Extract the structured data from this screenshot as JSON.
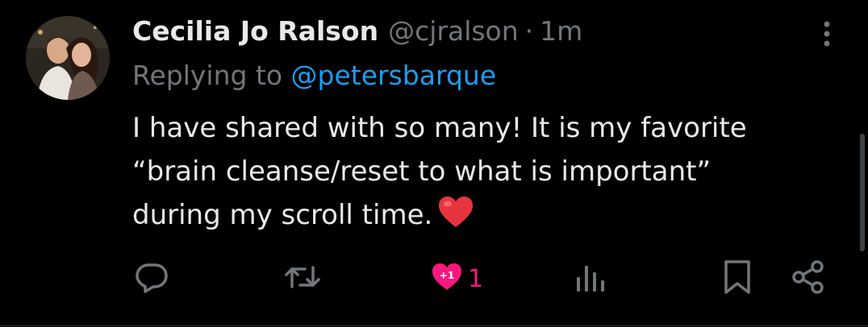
{
  "tweet": {
    "display_name": "Cecilia Jo Ralson",
    "handle": "@cjralson",
    "separator": "·",
    "time": "1m",
    "replying_prefix": "Replying to ",
    "replying_to": "@petersbarque",
    "text_lines": [
      "I have shared with so many! It is my favorite",
      "“brain cleanse/reset to what is important”",
      "during my scroll time."
    ],
    "emoji": "red-heart",
    "like_count": "1",
    "like_badge": "+1"
  },
  "icons": {
    "more": "more-vertical-icon",
    "reply": "reply-icon",
    "retweet": "retweet-icon",
    "like": "heart-plus-one-icon",
    "views": "views-bar-chart-icon",
    "bookmark": "bookmark-icon",
    "share": "share-icon"
  },
  "colors": {
    "background": "#000000",
    "primary_text": "#e7e9ea",
    "secondary_text": "#71767b",
    "link": "#1d9bf0",
    "like": "#f91880"
  }
}
